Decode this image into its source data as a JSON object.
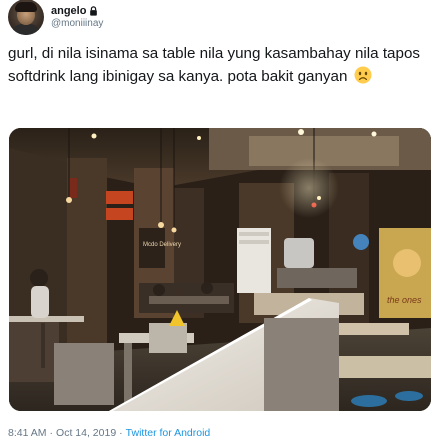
{
  "user": {
    "display_name": "angelo",
    "handle": "@moniiinay",
    "protected_icon": "lock-icon"
  },
  "tweet": {
    "text": "gurl, di nila isinama sa table nila yung kasambahay nila tapos softdrink lang ibinigay sa kanya. pota bakit ganyan",
    "emoji": "sad-face-emoji"
  },
  "photo": {
    "signs": [
      "Mcdo Delivery",
      "the ones"
    ]
  },
  "footer": {
    "time": "8:41 AM",
    "separator": "·",
    "date": "Oct 14, 2019",
    "source": "Twitter for Android"
  },
  "colors": {
    "text": "#14171a",
    "secondary": "#657786",
    "link": "#1b95e0"
  }
}
